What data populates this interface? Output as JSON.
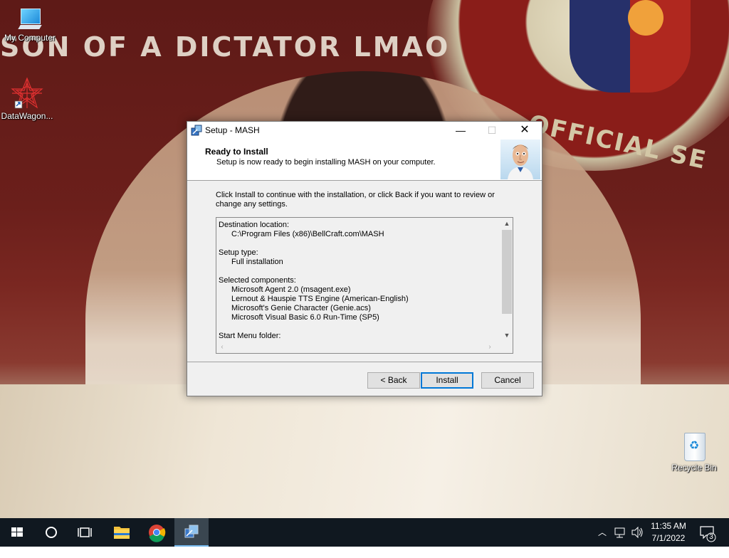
{
  "wallpaper": {
    "text": "SON OF A DICTATOR LMAO",
    "seal_text": "OFFICIAL SE"
  },
  "desktop_icons": [
    {
      "label": "My Computer",
      "icon": "computer-icon"
    },
    {
      "label": "DataWagon...",
      "icon": "datawagon-icon"
    },
    {
      "label": "Recycle Bin",
      "icon": "recycle-bin-icon"
    }
  ],
  "dialog": {
    "title": "Setup - MASH",
    "controls": {
      "minimize": "—",
      "maximize": "☐",
      "close": "✕"
    },
    "header_title": "Ready to Install",
    "header_subtitle": "Setup is now ready to begin installing MASH on your computer.",
    "intro": "Click Install to continue with the installation, or click Back if you want to review or change any settings.",
    "memo": {
      "destination_label": "Destination location:",
      "destination_value": "C:\\Program Files (x86)\\BellCraft.com\\MASH",
      "setup_type_label": "Setup type:",
      "setup_type_value": "Full installation",
      "components_label": "Selected components:",
      "components": [
        "Microsoft Agent 2.0 (msagent.exe)",
        "Lernout & Hauspie TTS Engine (American-English)",
        "Microsoft's Genie Character (Genie.acs)",
        "Microsoft Visual Basic 6.0 Run-Time (SP5)"
      ],
      "start_menu_label": "Start Menu folder:"
    },
    "buttons": {
      "back": "< Back",
      "install": "Install",
      "cancel": "Cancel"
    }
  },
  "taskbar": {
    "time": "11:35 AM",
    "date": "7/1/2022",
    "notification_count": "3",
    "items": [
      "start-icon",
      "search-icon",
      "task-view-icon",
      "file-explorer-icon",
      "chrome-icon",
      "setup-mash-icon"
    ]
  }
}
